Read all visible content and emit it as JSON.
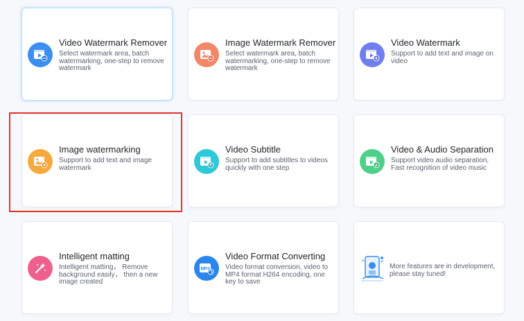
{
  "cards": [
    {
      "title": "Video Watermark Remover",
      "desc": "Select watermark area, batch watermarking, one-step to remove watermark",
      "icon": "video-eraser-icon",
      "color": "#3b8ff0"
    },
    {
      "title": "Image Watermark Remover",
      "desc": "Select watermark area, batch watermarking, one-step to remove watermark",
      "icon": "image-eraser-icon",
      "color": "#f3876a"
    },
    {
      "title": "Video Watermark",
      "desc": "Support to add text and image on video",
      "icon": "video-watermark-icon",
      "color": "#6f7ff0"
    },
    {
      "title": "Image watermarking",
      "desc": "Support to add text and image watermark",
      "icon": "image-watermark-icon",
      "color": "#f7a93c"
    },
    {
      "title": "Video Subtitle",
      "desc": "Support to add subtitles to videos quickly with one step",
      "icon": "video-subtitle-icon",
      "color": "#2ec9d9"
    },
    {
      "title": "Video & Audio Separation",
      "desc": "Support video audio separation, Fast recognition of video music",
      "icon": "audio-separation-icon",
      "color": "#4fd08a"
    },
    {
      "title": "Intelligent matting",
      "desc": "Intelligent matting， Remove background easily， then a new image created",
      "icon": "magic-wand-icon",
      "color": "#f0608e"
    },
    {
      "title": "Video Format Converting",
      "desc": "Video format conversion, video to MP4 format H264 encoding, one key to save",
      "icon": "mp4-convert-icon",
      "color": "#2a86ec",
      "badge": "MP4"
    },
    {
      "desc": "More features are in development, please stay tuned!",
      "icon": "coming-soon-illustration"
    }
  ]
}
